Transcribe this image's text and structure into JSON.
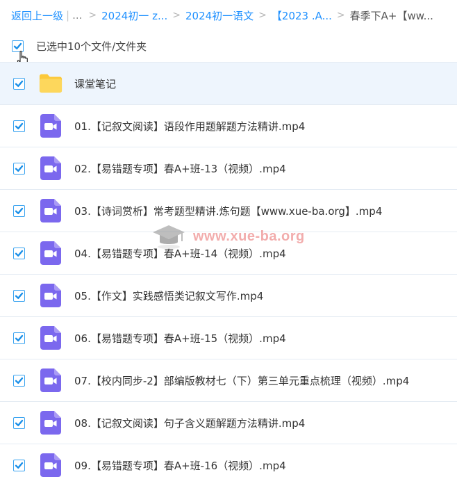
{
  "breadcrumb": {
    "back": "返回上一级",
    "ellipsis": "...",
    "items": [
      "2024初一 z...",
      "2024初一语文",
      "【2023 .A...",
      "春季下A+【ww..."
    ]
  },
  "selection": {
    "label": "已选中10个文件/文件夹"
  },
  "files": [
    {
      "name": "课堂笔记",
      "type": "folder"
    },
    {
      "name": "01.【记叙文阅读】语段作用题解题方法精讲.mp4",
      "type": "video"
    },
    {
      "name": "02.【易错题专项】春A+班-13（视频）.mp4",
      "type": "video"
    },
    {
      "name": "03.【诗词赏析】常考题型精讲.炼句题【www.xue-ba.org】.mp4",
      "type": "video"
    },
    {
      "name": "04.【易错题专项】春A+班-14（视频）.mp4",
      "type": "video"
    },
    {
      "name": "05.【作文】实践感悟类记叙文写作.mp4",
      "type": "video"
    },
    {
      "name": "06.【易错题专项】春A+班-15（视频）.mp4",
      "type": "video"
    },
    {
      "name": "07.【校内同步-2】部编版教材七（下）第三单元重点梳理（视频）.mp4",
      "type": "video"
    },
    {
      "name": "08.【记叙文阅读】句子含义题解题方法精讲.mp4",
      "type": "video"
    },
    {
      "name": "09.【易错题专项】春A+班-16（视频）.mp4",
      "type": "video"
    }
  ],
  "watermark": "www.xue-ba.org",
  "colors": {
    "link": "#1e90ff",
    "checkbox": "#1a8fe8",
    "folder": "#fcc93b",
    "video": "#7b68ee",
    "selected_row": "#eef5fd"
  }
}
